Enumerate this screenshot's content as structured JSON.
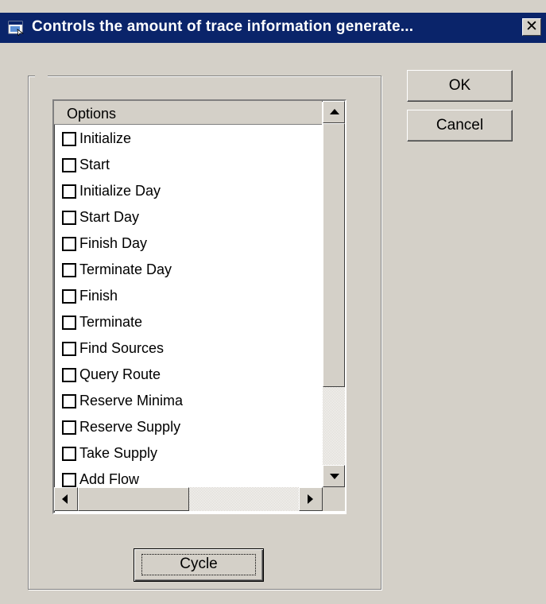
{
  "window": {
    "title": "Controls the amount of trace information generate...",
    "close_glyph": "✕",
    "icon": "app-window-icon"
  },
  "list": {
    "header": "Options",
    "items": [
      "Initialize",
      "Start",
      "Initialize Day",
      "Start Day",
      "Finish Day",
      "Terminate Day",
      "Finish",
      "Terminate",
      "Find Sources",
      "Query Route",
      "Reserve Minima",
      "Reserve Supply",
      "Take Supply",
      "Add Flow"
    ]
  },
  "buttons": {
    "ok_label": "OK",
    "cancel_label": "Cancel",
    "cycle_label": "Cycle"
  },
  "colors": {
    "face": "#d4d0c8",
    "titlebar": "#0a246a"
  }
}
